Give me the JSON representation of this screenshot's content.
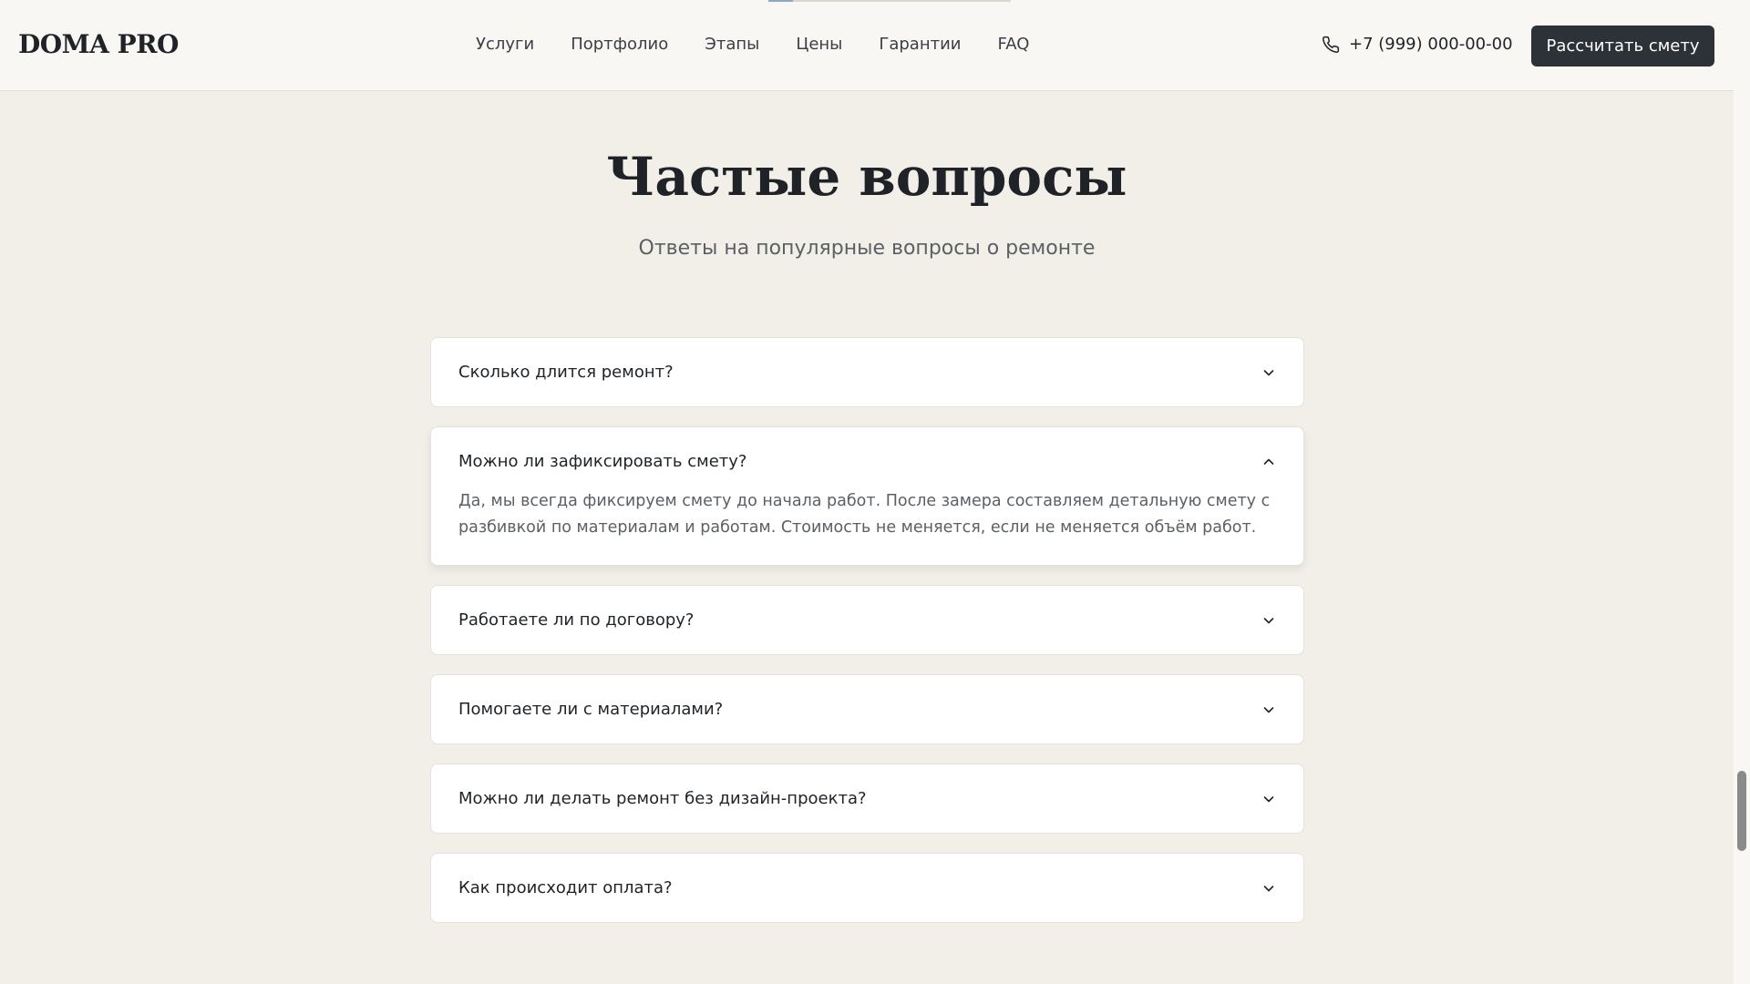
{
  "header": {
    "logo": "DOMA PRO",
    "nav": [
      "Услуги",
      "Портфолио",
      "Этапы",
      "Цены",
      "Гарантии",
      "FAQ"
    ],
    "phone": "+7 (999) 000-00-00",
    "phone_icon": "phone-icon",
    "cta_label": "Рассчитать смету"
  },
  "faq": {
    "title": "Частые вопросы",
    "subtitle": "Ответы на популярные вопросы о ремонте",
    "items": [
      {
        "question": "Сколько длится ремонт?",
        "answer": "",
        "open": false
      },
      {
        "question": "Можно ли зафиксировать смету?",
        "answer": "Да, мы всегда фиксируем смету до начала работ. После замера составляем детальную смету с разбивкой по материалам и работам. Стоимость не меняется, если не меняется объём работ.",
        "open": true
      },
      {
        "question": "Работаете ли по договору?",
        "answer": "",
        "open": false
      },
      {
        "question": "Помогаете ли с материалами?",
        "answer": "",
        "open": false
      },
      {
        "question": "Можно ли делать ремонт без дизайн-проекта?",
        "answer": "",
        "open": false
      },
      {
        "question": "Как происходит оплата?",
        "answer": "",
        "open": false
      }
    ]
  },
  "colors": {
    "background": "#f2efe9",
    "header_bg": "#f8f7f4",
    "cta_bg": "#2d3238",
    "text": "#1f2328",
    "muted": "#5b5f66"
  }
}
